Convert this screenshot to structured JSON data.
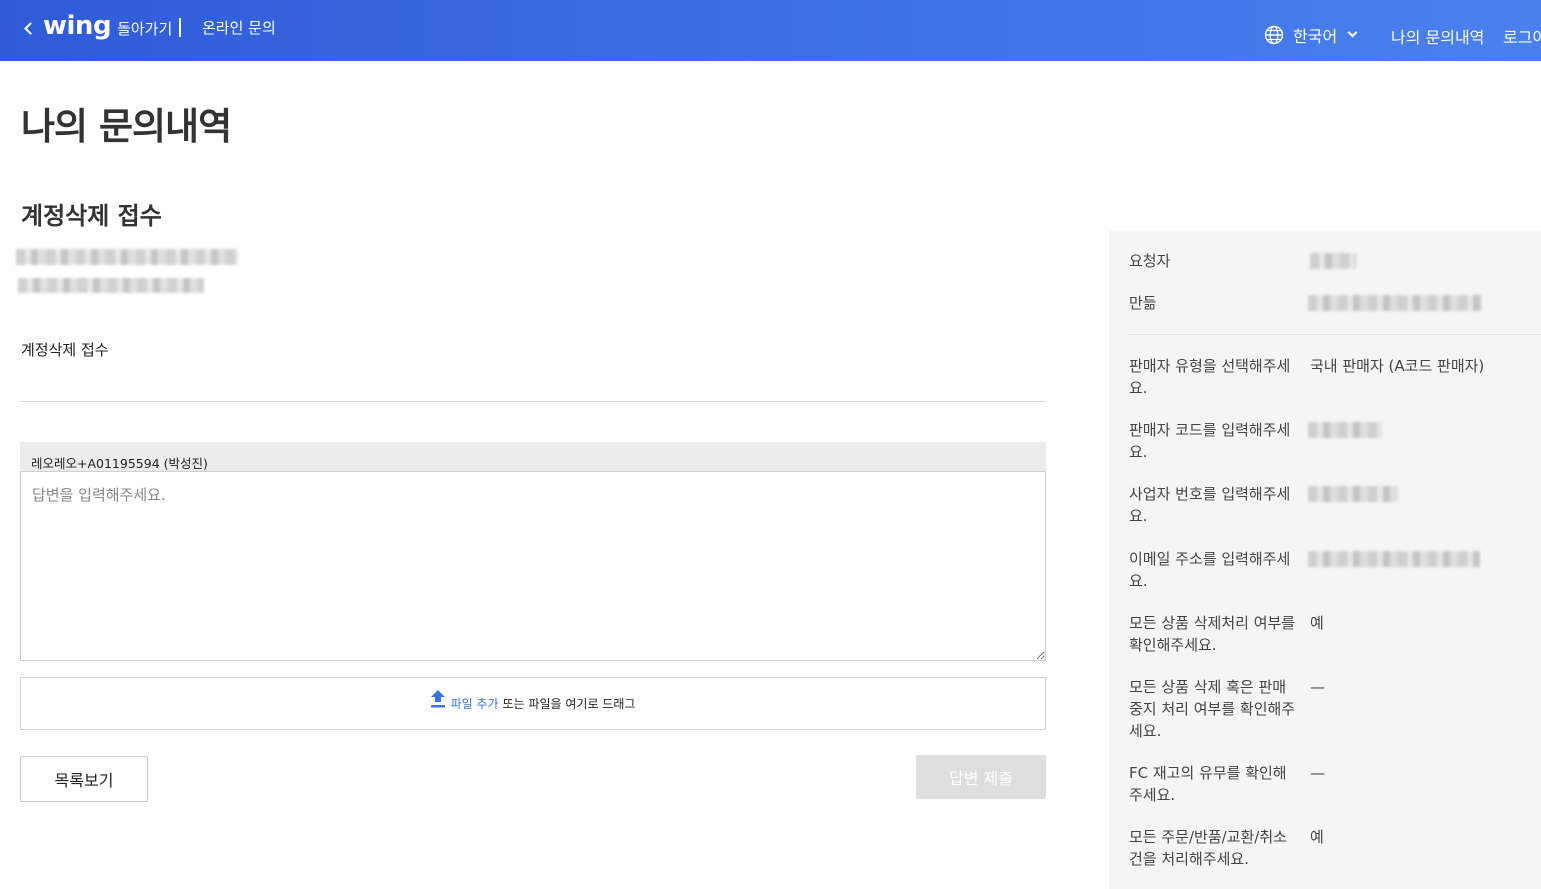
{
  "header": {
    "logo": "wing",
    "back_label": "돌아가기",
    "title": "온라인 문의",
    "language": "한국어",
    "my_inquiries": "나의 문의내역",
    "logout": "로그아웃",
    "icons": [
      "chevron-left-icon",
      "globe-icon",
      "chevron-down-icon"
    ]
  },
  "page": {
    "title": "나의 문의내역",
    "section_title": "계정삭제 접수",
    "inquiry_body": "계정삭제 접수"
  },
  "reply": {
    "author": "레오레오+A01195594 (박성진)",
    "placeholder": "답변을 입력해주세요."
  },
  "upload": {
    "link_label": "파일 추가",
    "hint": "또는 파일을 여기로 드래그",
    "icon": "upload-icon"
  },
  "buttons": {
    "list": "목록보기",
    "submit": "답변 제출"
  },
  "details": {
    "requester_label": "요청자",
    "created_label": "만듦",
    "fields": [
      {
        "label": "판매자 유형을 선택해주세요.",
        "value": "국내 판매자 (A코드 판매자)"
      },
      {
        "label": "판매자 코드를 입력해주세요.",
        "value": ""
      },
      {
        "label": "사업자 번호를 입력해주세요.",
        "value": ""
      },
      {
        "label": "이메일 주소를 입력해주세요.",
        "value": ""
      },
      {
        "label": "모든 상품 삭제처리 여부를 확인해주세요.",
        "value": "예"
      },
      {
        "label": "모든 상품 삭제 혹은 판매중지 처리 여부를 확인해주세요.",
        "value": "—"
      },
      {
        "label": "FC 재고의 유무를 확인해주세요.",
        "value": "—"
      },
      {
        "label": "모든 주문/반품/교환/취소건을 처리해주세요.",
        "value": "예"
      }
    ]
  },
  "colors": {
    "header_start": "#2f5bd8",
    "header_end": "#4a80ee",
    "link": "#3b73e4",
    "panel_bg": "#f5f5f5",
    "disabled_button": "#dedede"
  }
}
